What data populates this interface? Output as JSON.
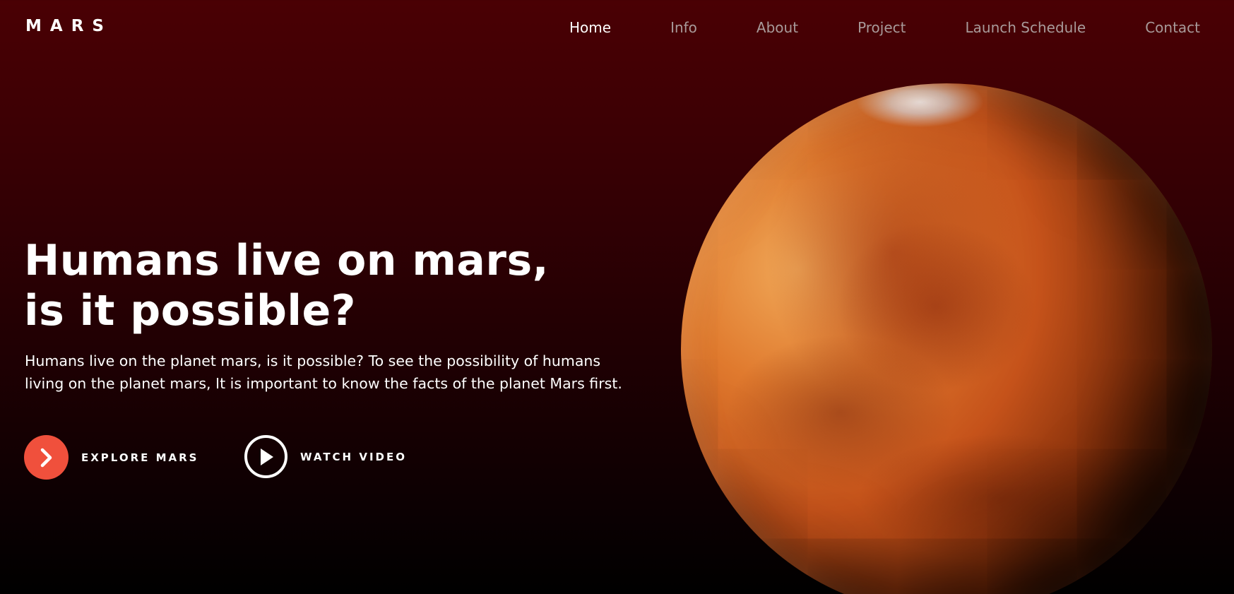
{
  "header": {
    "brand": "MARS",
    "nav": [
      {
        "label": "Home",
        "active": true
      },
      {
        "label": "Info",
        "active": false
      },
      {
        "label": "About",
        "active": false
      },
      {
        "label": "Project",
        "active": false
      },
      {
        "label": "Launch Schedule",
        "active": false
      },
      {
        "label": "Contact",
        "active": false
      }
    ]
  },
  "hero": {
    "title_line1": "Humans live on mars,",
    "title_line2": "is it possible?",
    "description": "Humans live on the planet mars, is it possible? To see the possibility of humans living on the planet mars, It is important to know the facts of the planet Mars first.",
    "explore_label": "EXPLORE MARS",
    "video_label": "WATCH VIDEO"
  },
  "icons": {
    "explore": "chevron-right-icon",
    "video": "play-icon"
  },
  "colors": {
    "accent": "#f0503c",
    "background_top": "#4a0004",
    "background_bottom": "#000000",
    "nav_inactive": "#a89a9a"
  }
}
